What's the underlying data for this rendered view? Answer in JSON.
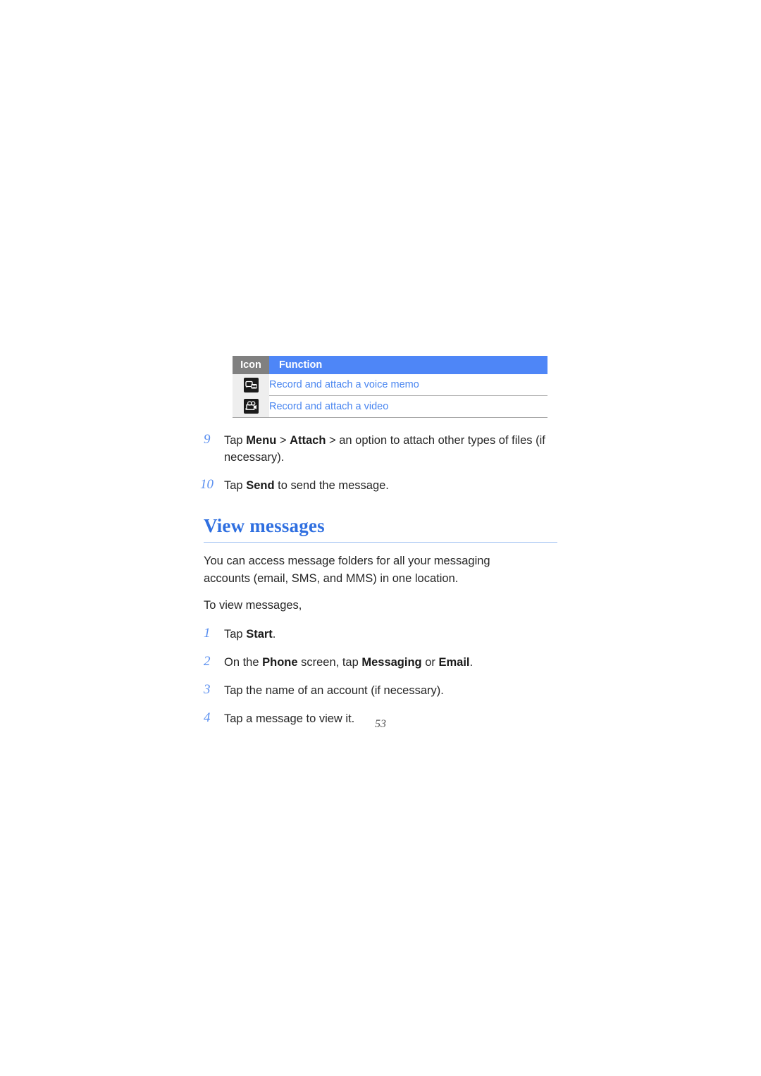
{
  "document": {
    "page_number": "53"
  },
  "icon_table": {
    "headers": {
      "icon": "Icon",
      "function": "Function"
    },
    "rows": [
      {
        "icon_name": "voice-memo-icon",
        "function": "Record and attach a voice memo"
      },
      {
        "icon_name": "video-camera-icon",
        "function": "Record and attach a video"
      }
    ]
  },
  "steps_top": [
    {
      "number": "9",
      "parts": [
        {
          "text": "Tap ",
          "bold": false
        },
        {
          "text": "Menu",
          "bold": true
        },
        {
          "text": " > ",
          "bold": false
        },
        {
          "text": "Attach",
          "bold": true
        },
        {
          "text": " > an option to attach other types of files (if necessary).",
          "bold": false
        }
      ]
    },
    {
      "number": "10",
      "parts": [
        {
          "text": "Tap ",
          "bold": false
        },
        {
          "text": "Send",
          "bold": true
        },
        {
          "text": " to send the message.",
          "bold": false
        }
      ]
    }
  ],
  "section": {
    "heading": "View messages",
    "paragraphs": [
      "You can access message folders for all your messaging accounts (email, SMS, and MMS) in one location.",
      "To view messages,"
    ]
  },
  "steps_bottom": [
    {
      "number": "1",
      "parts": [
        {
          "text": "Tap ",
          "bold": false
        },
        {
          "text": "Start",
          "bold": true
        },
        {
          "text": ".",
          "bold": false
        }
      ]
    },
    {
      "number": "2",
      "parts": [
        {
          "text": "On the ",
          "bold": false
        },
        {
          "text": "Phone",
          "bold": true
        },
        {
          "text": " screen, tap ",
          "bold": false
        },
        {
          "text": "Messaging",
          "bold": true
        },
        {
          "text": " or ",
          "bold": false
        },
        {
          "text": "Email",
          "bold": true
        },
        {
          "text": ".",
          "bold": false
        }
      ]
    },
    {
      "number": "3",
      "parts": [
        {
          "text": "Tap the name of an account (if necessary).",
          "bold": false
        }
      ]
    },
    {
      "number": "4",
      "parts": [
        {
          "text": "Tap a message to view it.",
          "bold": false
        }
      ]
    }
  ],
  "colors": {
    "header_blue": "#4e86f7",
    "header_gray": "#808080",
    "link_blue": "#4a86f0",
    "heading_blue": "#2f6fe0",
    "number_blue": "#5a8ff0",
    "row_gray": "#eeeeee",
    "rule_gray": "#a9a9a9",
    "heading_rule": "#9dc0f2",
    "body_text": "#262626"
  }
}
